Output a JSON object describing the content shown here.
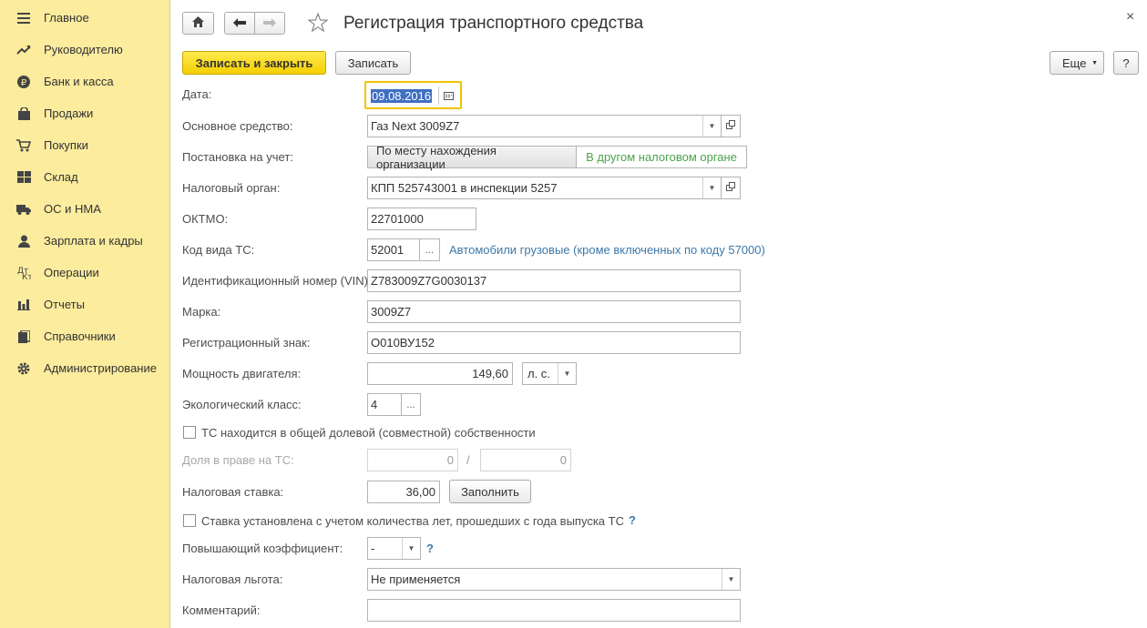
{
  "sidebar": {
    "items": [
      {
        "label": "Главное",
        "icon": "menu-icon"
      },
      {
        "label": "Руководителю",
        "icon": "trend-icon"
      },
      {
        "label": "Банк и касса",
        "icon": "ruble-icon"
      },
      {
        "label": "Продажи",
        "icon": "bag-icon"
      },
      {
        "label": "Покупки",
        "icon": "cart-icon"
      },
      {
        "label": "Склад",
        "icon": "warehouse-icon"
      },
      {
        "label": "ОС и НМА",
        "icon": "truck-icon"
      },
      {
        "label": "Зарплата и кадры",
        "icon": "person-icon"
      },
      {
        "label": "Операции",
        "icon": "operations-icon"
      },
      {
        "label": "Отчеты",
        "icon": "bar-chart-icon"
      },
      {
        "label": "Справочники",
        "icon": "book-icon"
      },
      {
        "label": "Администрирование",
        "icon": "gear-icon"
      }
    ]
  },
  "header": {
    "title": "Регистрация транспортного средства",
    "close": "×"
  },
  "toolbar": {
    "save_close": "Записать и закрыть",
    "save": "Записать",
    "more": "Еще",
    "help": "?"
  },
  "form": {
    "date_label": "Дата:",
    "date_value": "09.08.2016",
    "asset_label": "Основное средство:",
    "asset_value": "Газ Next 3009Z7",
    "registration_label": "Постановка на учет:",
    "registration_opt1": "По месту нахождения организации",
    "registration_opt2": "В другом налоговом органе",
    "tax_office_label": "Налоговый орган:",
    "tax_office_value": "КПП 525743001 в инспекции 5257",
    "oktmo_label": "ОКТМО:",
    "oktmo_value": "22701000",
    "vehicle_code_label": "Код вида ТС:",
    "vehicle_code_value": "52001",
    "vehicle_code_desc": "Автомобили грузовые (кроме включенных по коду 57000)",
    "vin_label": "Идентификационный номер (VIN):",
    "vin_value": "Z783009Z7G0030137",
    "brand_label": "Марка:",
    "brand_value": "3009Z7",
    "reg_sign_label": "Регистрационный знак:",
    "reg_sign_value": "О010ВУ152",
    "power_label": "Мощность двигателя:",
    "power_value": "149,60",
    "power_unit": "л. с.",
    "eco_label": "Экологический класс:",
    "eco_value": "4",
    "shared_ownership_label": "ТС находится в общей долевой (совместной) собственности",
    "share_label": "Доля в праве на ТС:",
    "share_num": "0",
    "share_sep": "/",
    "share_den": "0",
    "rate_label": "Налоговая ставка:",
    "rate_value": "36,00",
    "fill_button": "Заполнить",
    "years_label": "Ставка установлена с учетом количества лет, прошедших с года выпуска ТС",
    "help_mark": "?",
    "coef_label": "Повышающий коэффициент:",
    "coef_value": "-",
    "benefit_label": "Налоговая льгота:",
    "benefit_value": "Не применяется",
    "comment_label": "Комментарий:",
    "comment_value": ""
  },
  "colors": {
    "sidebar_bg": "#fbec9e",
    "primary_button": "#f5cf00",
    "link": "#3e78a8",
    "active_option": "#4ca34c"
  }
}
